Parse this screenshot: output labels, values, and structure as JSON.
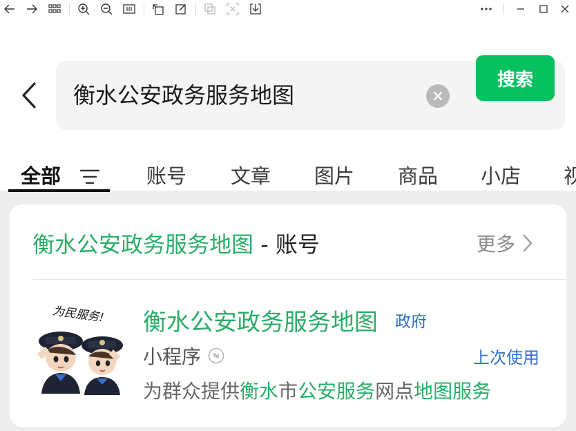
{
  "colors": {
    "accent_green": "#07c160",
    "highlight_green": "#2aae67",
    "link_blue": "#2f6fc8"
  },
  "toolbar": {
    "icons": [
      "back-arrow-icon",
      "forward-arrow-icon",
      "grid-icon",
      "zoom-in-icon",
      "zoom-out-icon",
      "fit-page-icon",
      "rotate-icon",
      "edit-icon",
      "copy-icon",
      "scan-icon",
      "download-icon",
      "more-dots-icon",
      "minimize-icon",
      "maximize-icon",
      "close-icon"
    ]
  },
  "search": {
    "query": "衡水公安政务服务地图",
    "button_label": "搜索"
  },
  "tabs": [
    {
      "label": "全部"
    },
    {
      "label": "账号"
    },
    {
      "label": "文章"
    },
    {
      "label": "图片"
    },
    {
      "label": "商品"
    },
    {
      "label": "小店"
    },
    {
      "label": "视"
    }
  ],
  "card": {
    "header_highlight": "衡水公安政务服务地图",
    "header_rest": " - 账号",
    "more_label": "更多",
    "result": {
      "avatar_caption": "为民服务!",
      "title": "衡水公安政务服务地图",
      "gov_tag": "政府",
      "kind": "小程序",
      "last_used": "上次使用",
      "desc_parts": [
        {
          "text": "为群众提供",
          "hl": false
        },
        {
          "text": "衡水",
          "hl": true
        },
        {
          "text": "市",
          "hl": false
        },
        {
          "text": "公安服务",
          "hl": true
        },
        {
          "text": "网点",
          "hl": false
        },
        {
          "text": "地图服务",
          "hl": true
        }
      ]
    }
  }
}
